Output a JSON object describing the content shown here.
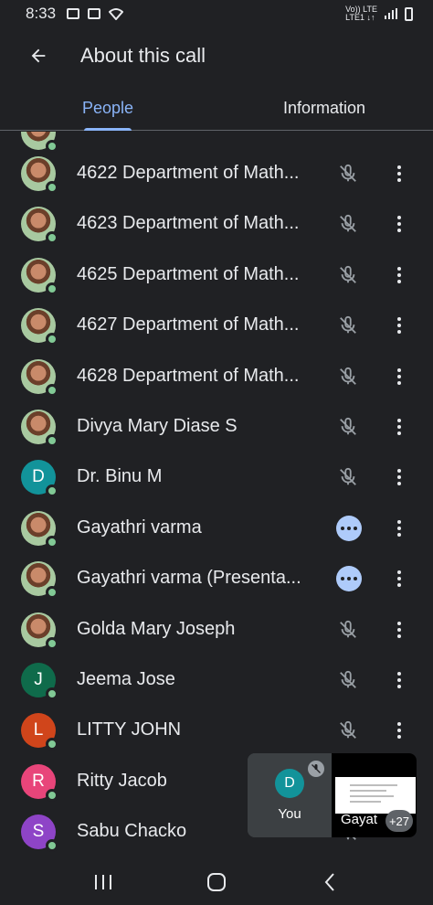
{
  "status_bar": {
    "time": "8:33",
    "net_top": "Vo)) LTE",
    "net_bottom": "LTE1 ↓↑"
  },
  "header": {
    "title": "About this call"
  },
  "tabs": [
    {
      "label": "People",
      "active": true
    },
    {
      "label": "Information",
      "active": false
    }
  ],
  "participants": [
    {
      "name": "4622 Department of Math...",
      "avatar": "photo",
      "status": "muted"
    },
    {
      "name": "4623 Department of Math...",
      "avatar": "photo",
      "status": "muted"
    },
    {
      "name": "4625 Department of Math...",
      "avatar": "photo",
      "status": "muted"
    },
    {
      "name": "4627 Department of Math...",
      "avatar": "photo",
      "status": "muted"
    },
    {
      "name": "4628 Department of Math...",
      "avatar": "photo",
      "status": "muted"
    },
    {
      "name": "Divya Mary Diase S",
      "avatar": "photo",
      "status": "muted"
    },
    {
      "name": "Dr. Binu M",
      "avatar": "D",
      "avatar_color": "#12939a",
      "status": "muted"
    },
    {
      "name": "Gayathri varma",
      "avatar": "photo",
      "status": "speaking"
    },
    {
      "name": "Gayathri varma (Presenta...",
      "avatar": "photo",
      "status": "speaking"
    },
    {
      "name": "Golda Mary Joseph",
      "avatar": "photo",
      "status": "muted"
    },
    {
      "name": "Jeema Jose",
      "avatar": "J",
      "avatar_color": "#0f6b4b",
      "status": "muted"
    },
    {
      "name": "LITTY JOHN",
      "avatar": "L",
      "avatar_color": "#d0451b",
      "status": "muted"
    },
    {
      "name": "Ritty Jacob",
      "avatar": "R",
      "avatar_color": "#e8457a",
      "status": "muted"
    },
    {
      "name": "Sabu Chacko",
      "avatar": "S",
      "avatar_color": "#8e44c7",
      "status": "muted"
    }
  ],
  "pip": {
    "self_initial": "D",
    "self_label": "You",
    "other_label": "Gayat",
    "extra_count": "+27"
  },
  "colors": {
    "background": "#202124",
    "accent": "#8ab4f8",
    "online": "#81c995",
    "speaking": "#aecbfa"
  }
}
